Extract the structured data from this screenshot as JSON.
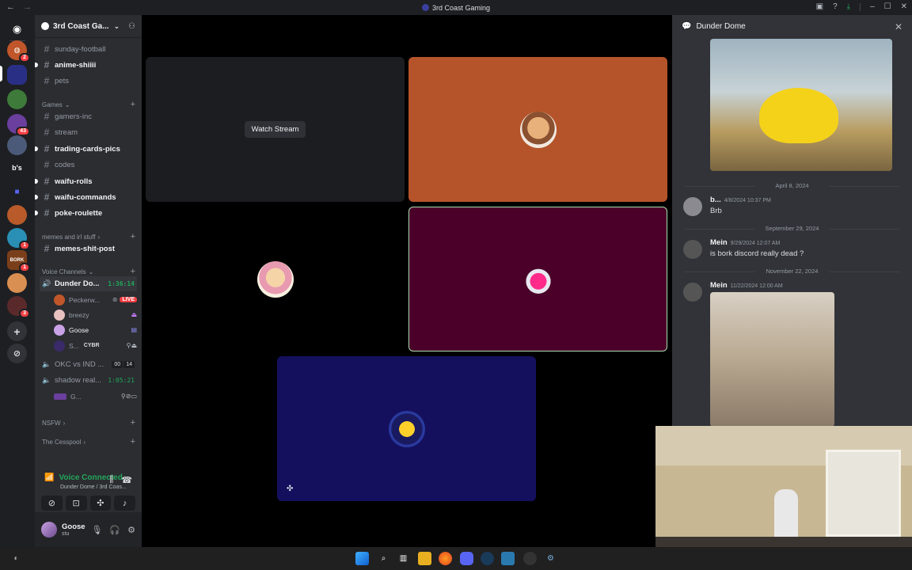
{
  "window": {
    "title": "3rd Coast Gaming"
  },
  "rail": {
    "servers": [
      {
        "abbr": "",
        "badge": "2"
      },
      {
        "abbr": "",
        "badge": ""
      },
      {
        "abbr": "",
        "badge": ""
      },
      {
        "abbr": "",
        "badge": "43"
      },
      {
        "abbr": "",
        "badge": ""
      },
      {
        "abbr": "b's",
        "badge": ""
      },
      {
        "abbr": "",
        "badge": ""
      },
      {
        "abbr": "",
        "badge": ""
      },
      {
        "abbr": "",
        "badge": "1"
      },
      {
        "abbr": "BORK",
        "badge": "1"
      },
      {
        "abbr": "",
        "badge": ""
      },
      {
        "abbr": "",
        "badge": "3"
      }
    ]
  },
  "sidebar": {
    "server_name": "3rd Coast Ga...",
    "channels_top": [
      {
        "name": "sunday-football",
        "unread": false
      },
      {
        "name": "anime-shiiii",
        "unread": true
      },
      {
        "name": "pets",
        "unread": false
      }
    ],
    "cat_games": "Games",
    "channels_games": [
      {
        "name": "gamers-inc",
        "unread": false
      },
      {
        "name": "stream",
        "unread": false
      },
      {
        "name": "trading-cards-pics",
        "unread": true
      },
      {
        "name": "codes",
        "unread": false
      },
      {
        "name": "waifu-rolls",
        "unread": true
      },
      {
        "name": "waifu-commands",
        "unread": true
      },
      {
        "name": "poke-roulette",
        "unread": true
      }
    ],
    "cat_memes": "memes and irl stuff",
    "channel_memes": "memes-shit-post",
    "cat_voice": "Voice Channels",
    "voice": {
      "dunder": {
        "name": "Dunder Do...",
        "time": "1:36:14"
      },
      "users": [
        {
          "name": "Peckerw...",
          "tag": "LIVE"
        },
        {
          "name": "breezy",
          "tag": ""
        },
        {
          "name": "Goose",
          "tag": ""
        },
        {
          "name": "S...",
          "tag": "CYBR"
        }
      ],
      "okc": {
        "name": "OKC vs IND ...",
        "c1": "00",
        "c2": "14"
      },
      "shadow": {
        "name": "shadow real...",
        "time": "1:05:21"
      },
      "shadow_user": "G..."
    },
    "cat_nsfw": "NSFW",
    "cat_cesspool": "The Cesspool",
    "voice_status": {
      "title": "Voice Connected",
      "sub": "Dunder Dome / 3rd Coas..."
    },
    "user": {
      "name": "Goose",
      "status": "stu"
    }
  },
  "stage": {
    "watch_label": "Watch Stream"
  },
  "chat": {
    "channel": "Dunder Dome",
    "dividers": [
      "April 8, 2024",
      "September 29, 2024",
      "November 22, 2024"
    ],
    "messages": [
      {
        "author": "b...",
        "time": "4/8/2024 10:37 PM",
        "text": "Brb"
      },
      {
        "author": "Mein",
        "time": "9/29/2024 12:07 AM",
        "text": "is bork discord really dead ?"
      },
      {
        "author": "Mein",
        "time": "11/22/2024 12:00 AM",
        "text": ""
      }
    ]
  },
  "colors": {
    "accent": "#5865f2",
    "online": "#23a55a",
    "live": "#f23f43"
  }
}
